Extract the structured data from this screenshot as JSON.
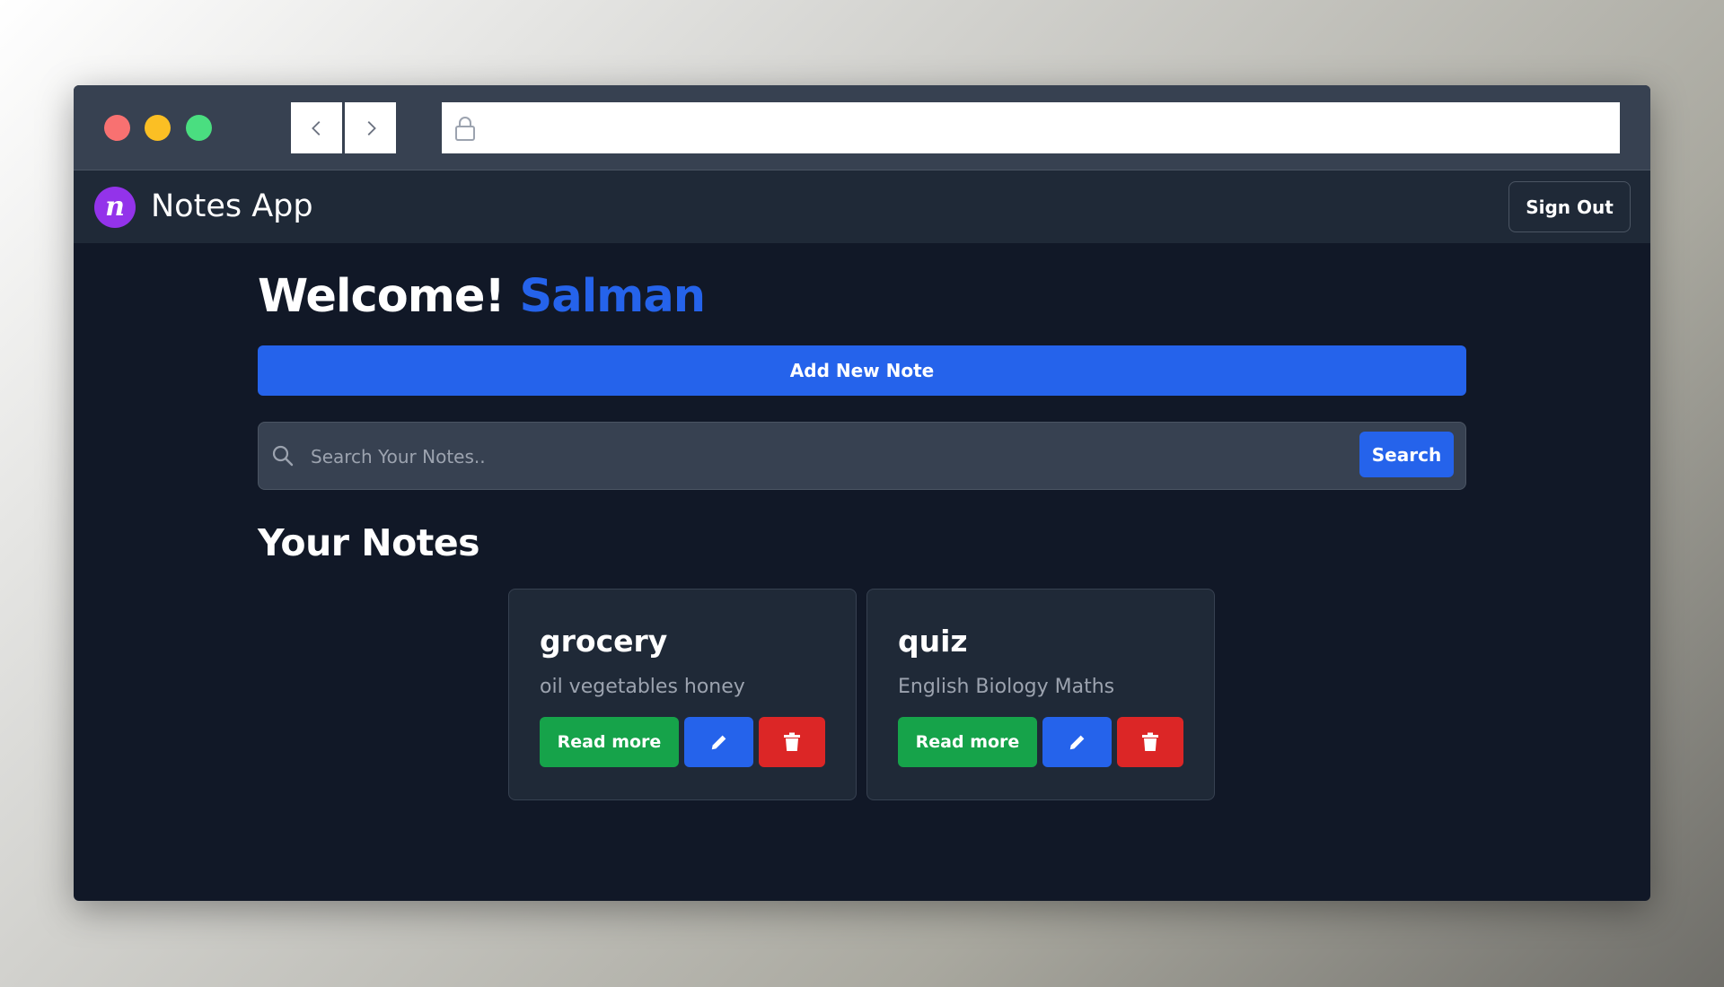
{
  "browser": {
    "url": "",
    "icons": {
      "back": "chevron-left-icon",
      "forward": "chevron-right-icon",
      "lock": "lock-icon"
    }
  },
  "header": {
    "logo_letter": "n",
    "app_title": "Notes App",
    "sign_out_label": "Sign Out"
  },
  "main": {
    "welcome_prefix": "Welcome!",
    "user_name": "Salman",
    "add_note_label": "Add New Note",
    "search": {
      "placeholder": "Search Your Notes..",
      "value": "",
      "button_label": "Search"
    },
    "notes_heading": "Your Notes",
    "notes": [
      {
        "title": "grocery",
        "body": "oil vegetables honey",
        "read_more_label": "Read more"
      },
      {
        "title": "quiz",
        "body": "English Biology Maths",
        "read_more_label": "Read more"
      }
    ]
  },
  "colors": {
    "brand_purple": "#9333ea",
    "primary_blue": "#2563eb",
    "success_green": "#16a34a",
    "danger_red": "#dc2626",
    "page_bg": "#111827",
    "nav_bg": "#1f2937"
  }
}
